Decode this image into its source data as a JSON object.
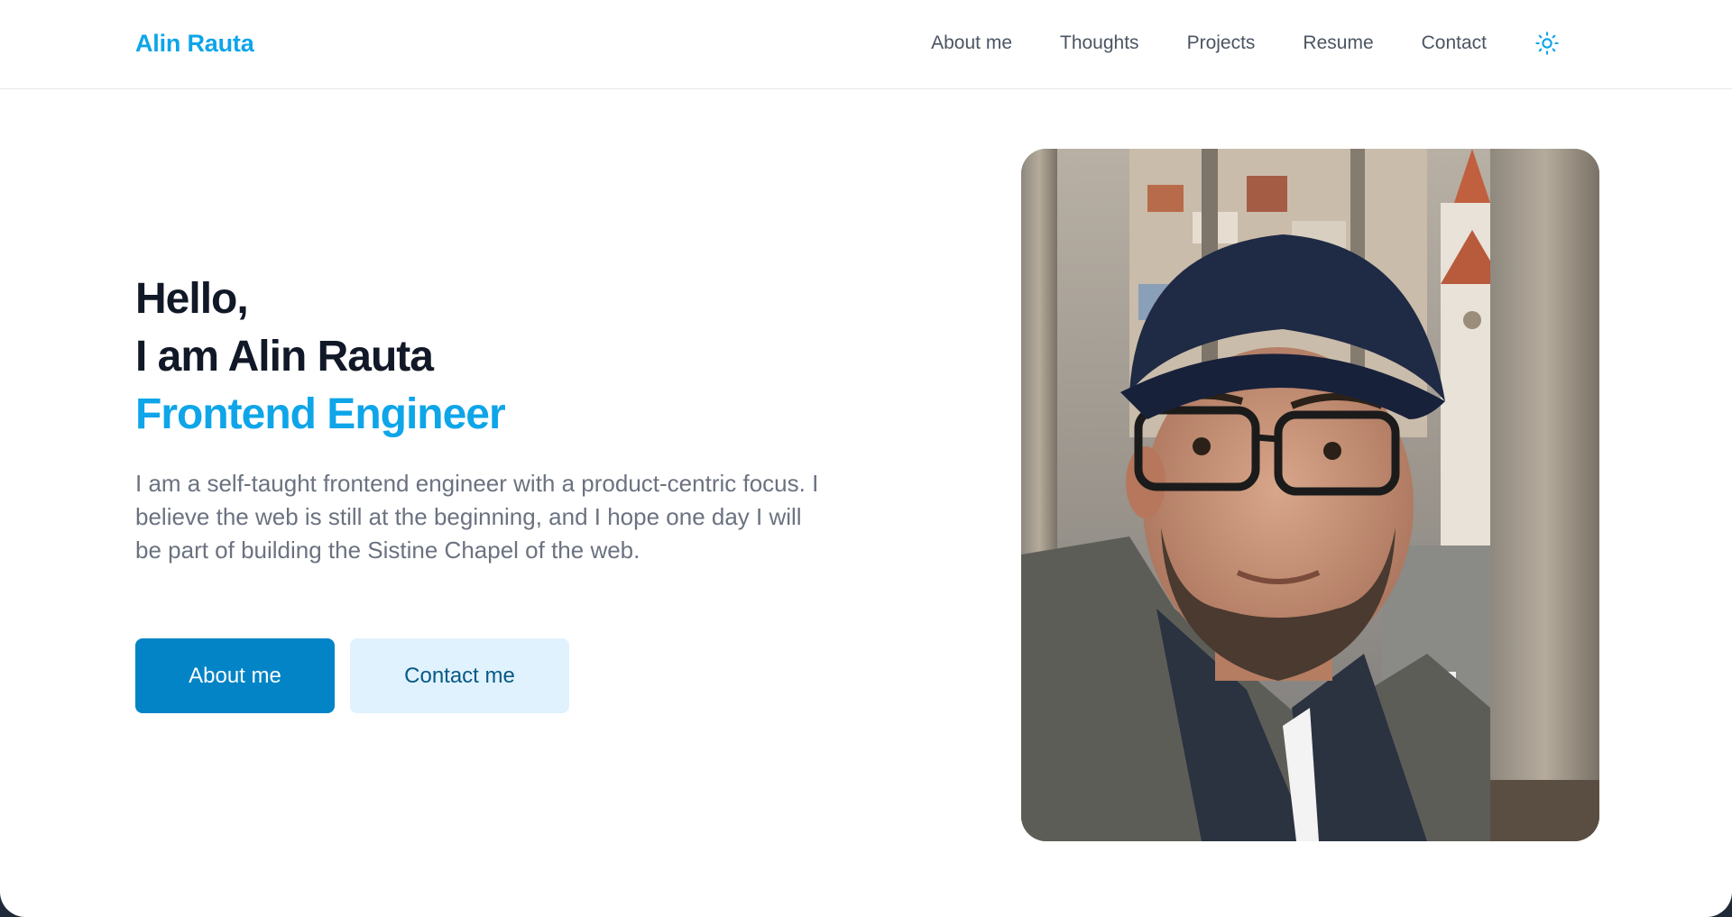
{
  "colors": {
    "accent": "#0ea5e9",
    "primary_button": "#0284c7",
    "secondary_button_bg": "#e0f2fe",
    "secondary_button_text": "#075985",
    "heading": "#111827",
    "body_text": "#6b7280",
    "nav_text": "#4b5563"
  },
  "header": {
    "brand": "Alin Rauta",
    "nav": [
      {
        "label": "About me"
      },
      {
        "label": "Thoughts"
      },
      {
        "label": "Projects"
      },
      {
        "label": "Resume"
      },
      {
        "label": "Contact"
      }
    ],
    "theme_icon": "sun-icon"
  },
  "hero": {
    "greeting": "Hello,",
    "intro": "I am Alin Rauta",
    "role": "Frontend Engineer",
    "description": "I am a self-taught frontend engineer with a product-centric focus. I believe the web is still at the beginning, and I hope one day I will be part of building the Sistine Chapel of the web.",
    "primary_cta": "About me",
    "secondary_cta": "Contact me"
  },
  "photo": {
    "subject": "portrait-photo"
  }
}
